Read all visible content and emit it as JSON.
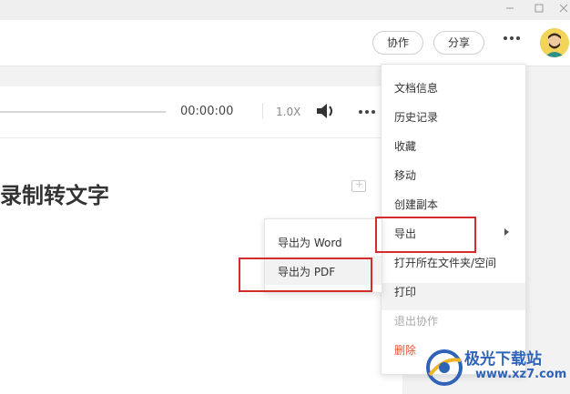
{
  "header": {
    "collab_label": "协作",
    "share_label": "分享"
  },
  "player": {
    "time": "00:00:00",
    "speed": "1.0X"
  },
  "doc": {
    "title": "录制转文字"
  },
  "menu": {
    "items": [
      {
        "label": "文档信息"
      },
      {
        "label": "历史记录"
      },
      {
        "label": "收藏"
      },
      {
        "label": "移动"
      },
      {
        "label": "创建副本"
      },
      {
        "label": "导出"
      },
      {
        "label": "打开所在文件夹/空间"
      },
      {
        "label": "打印"
      },
      {
        "label": "退出协作"
      },
      {
        "label": "删除"
      }
    ]
  },
  "submenu": {
    "items": [
      {
        "label": "导出为 Word"
      },
      {
        "label": "导出为 PDF"
      }
    ]
  },
  "watermark": {
    "brand": "极光下载站",
    "url": "www.xz7.com"
  },
  "colors": {
    "highlight_box": "#d62b2b",
    "danger_text": "#e5533a",
    "watermark": "#2f63b8"
  }
}
